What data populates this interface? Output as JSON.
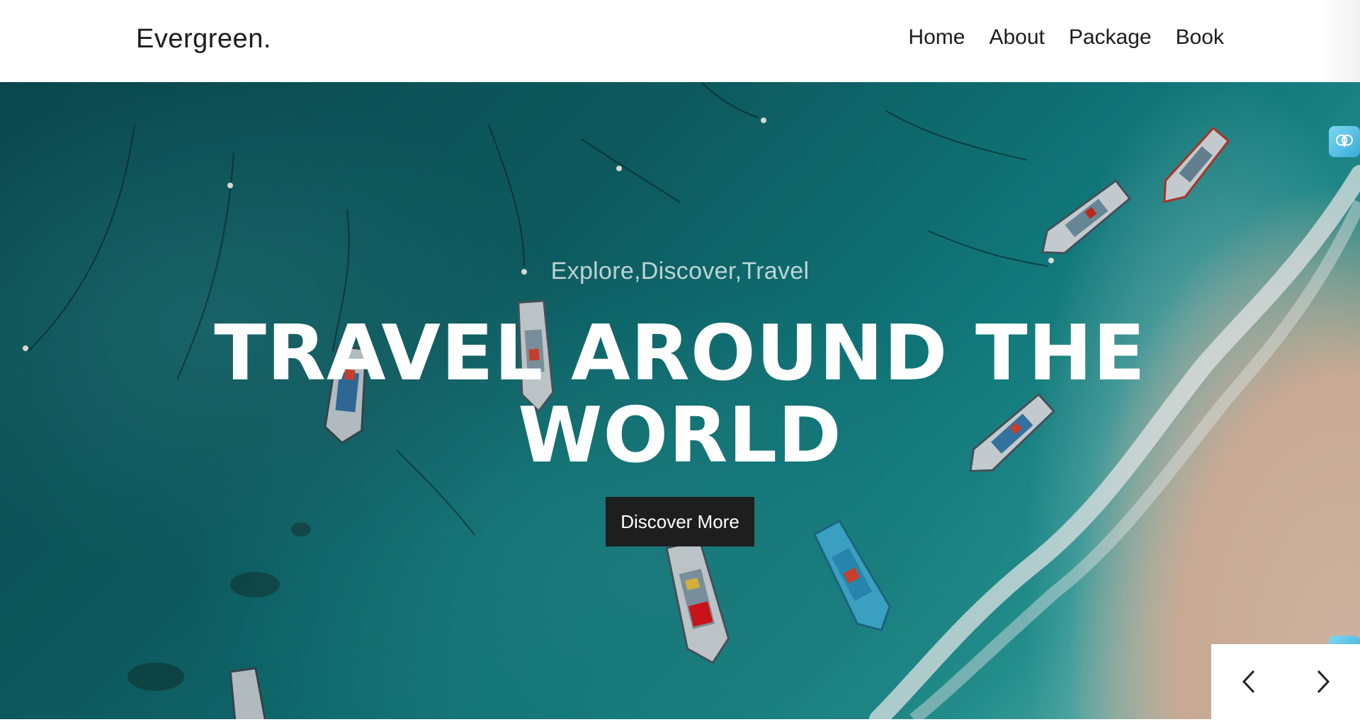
{
  "nav": {
    "brand": "Evergreen.",
    "links": [
      {
        "label": "Home"
      },
      {
        "label": "About"
      },
      {
        "label": "Package"
      },
      {
        "label": "Book"
      }
    ]
  },
  "hero": {
    "subtitle": "Explore,Discover,Travel",
    "headline_line1": "TRAVEL AROUND THE",
    "headline_line2": "WORLD",
    "cta_label": "Discover More"
  },
  "slider": {
    "prev_icon": "chevron-left-icon",
    "next_icon": "chevron-right-icon"
  },
  "extension_icons": [
    "brain-icon",
    "brain-icon",
    "brain-icon"
  ]
}
